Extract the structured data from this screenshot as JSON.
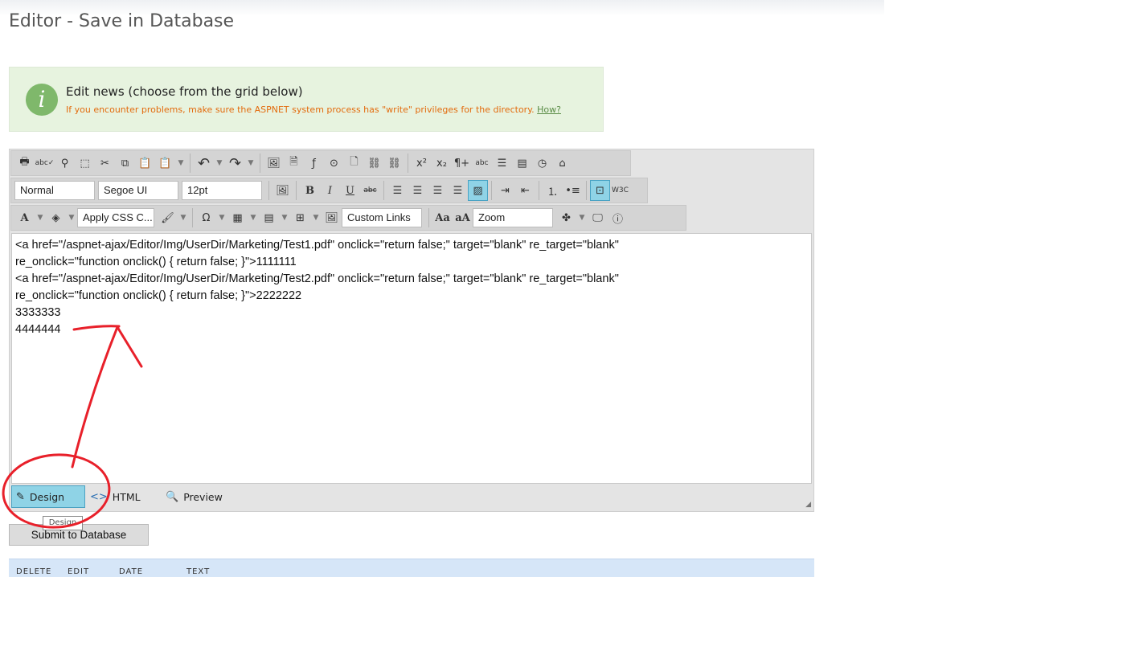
{
  "page": {
    "title": "Editor - Save in Database"
  },
  "info": {
    "icon": "info-icon",
    "title": "Edit news (choose from the grid below)",
    "note": "If you encounter problems, make sure the ASPNET system process has \"write\" privileges for the directory.",
    "link": "How?"
  },
  "toolbar": {
    "format_block": "Normal",
    "font_name": "Segoe UI",
    "font_size": "12pt",
    "css_class": "Apply CSS C...",
    "custom_links": "Custom Links",
    "zoom": "Zoom",
    "bold": "B",
    "italic": "I",
    "underline": "U",
    "strike": "abc",
    "font_color": "A",
    "symbol": "Ω",
    "case_upper": "Aa",
    "case_lower": "aA",
    "superscript": "x²",
    "subscript": "x₂"
  },
  "content": {
    "lines": [
      "<a href=\"/aspnet-ajax/Editor/Img/UserDir/Marketing/Test1.pdf\" onclick=\"return false;\" target=\"blank\" re_target=\"blank\"",
      "re_onclick=\"function onclick() { return false; }\">1111111",
      "<a href=\"/aspnet-ajax/Editor/Img/UserDir/Marketing/Test2.pdf\" onclick=\"return false;\" target=\"blank\" re_target=\"blank\"",
      "re_onclick=\"function onclick() { return false; }\">2222222",
      "3333333",
      "4444444"
    ]
  },
  "modes": {
    "design": "Design",
    "html": "HTML",
    "preview": "Preview",
    "tooltip": "Design"
  },
  "submit": {
    "label": "Submit to Database"
  },
  "grid": {
    "headers": [
      "DELETE",
      "EDIT",
      "DATE",
      "TEXT"
    ]
  },
  "colors": {
    "accent": "#8fd3e6",
    "info_bg": "#e7f3df",
    "warning": "#e36b0d",
    "annotation": "#e8202a"
  }
}
